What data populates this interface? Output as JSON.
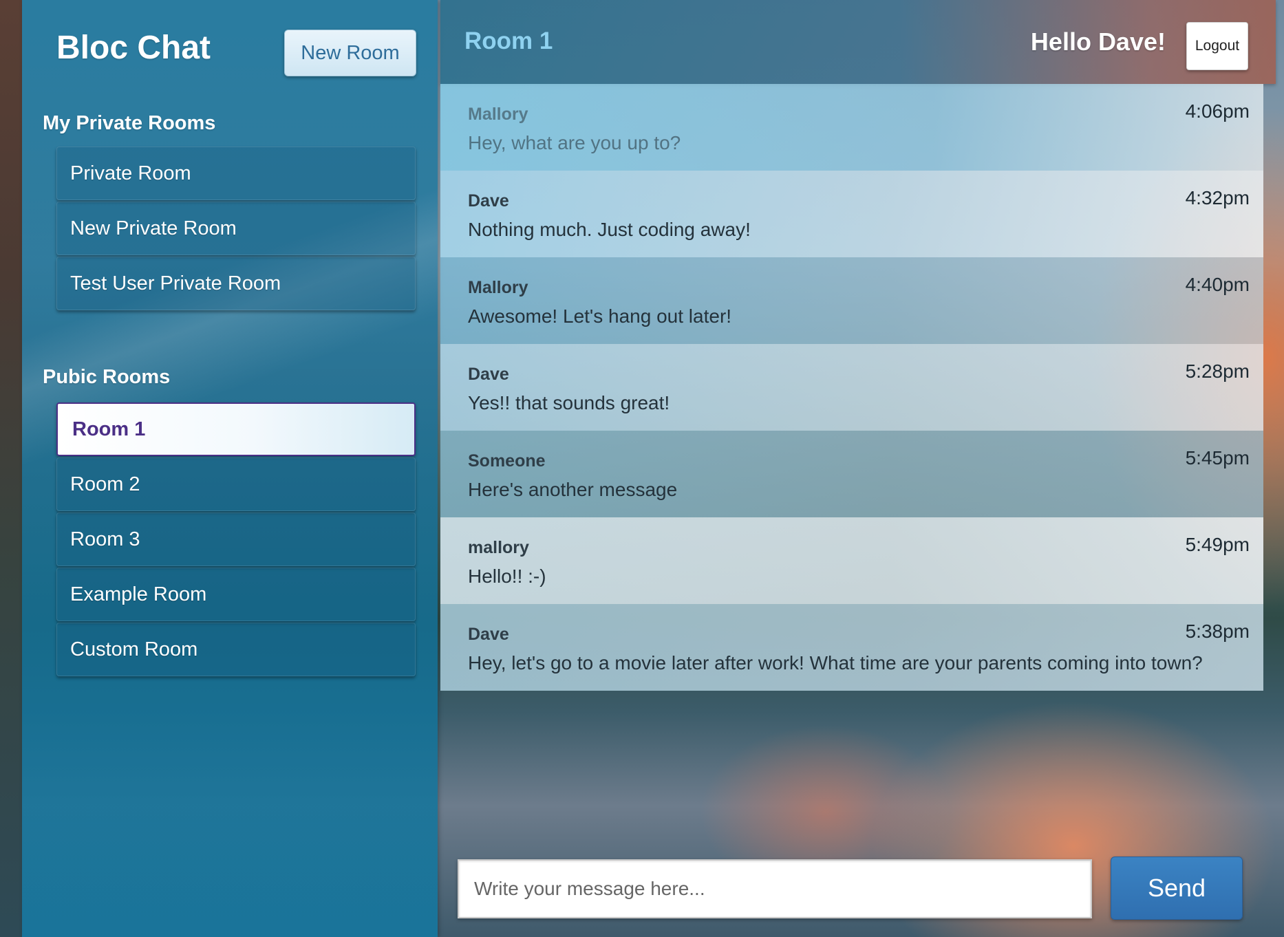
{
  "app": {
    "title": "Bloc Chat",
    "new_room_label": "New Room"
  },
  "sidebar": {
    "private_heading": "My Private Rooms",
    "private_rooms": [
      {
        "label": "Private Room"
      },
      {
        "label": "New Private Room"
      },
      {
        "label": "Test User Private Room"
      }
    ],
    "public_heading": "Pubic Rooms",
    "public_rooms": [
      {
        "label": "Room 1",
        "active": true
      },
      {
        "label": "Room 2"
      },
      {
        "label": "Room 3"
      },
      {
        "label": "Example Room"
      },
      {
        "label": "Custom Room"
      }
    ]
  },
  "header": {
    "room_title": "Room 1",
    "greeting": "Hello Dave!",
    "logout_label": "Logout"
  },
  "messages": [
    {
      "user": "Mallory",
      "text": "Hey, what are you up to?",
      "time": "4:06pm"
    },
    {
      "user": "Dave",
      "text": "Nothing much. Just coding away!",
      "time": "4:32pm"
    },
    {
      "user": "Mallory",
      "text": "Awesome! Let's hang out later!",
      "time": "4:40pm"
    },
    {
      "user": "Dave",
      "text": "Yes!! that sounds great!",
      "time": "5:28pm"
    },
    {
      "user": "Someone",
      "text": "Here's another message",
      "time": "5:45pm"
    },
    {
      "user": "mallory",
      "text": "Hello!! :-)",
      "time": "5:49pm"
    },
    {
      "user": "Dave",
      "text": "Hey, let's go to a movie later after work! What time are your parents coming into town?",
      "time": "5:38pm"
    }
  ],
  "composer": {
    "placeholder": "Write your message here...",
    "value": "",
    "send_label": "Send"
  },
  "colors": {
    "sidebar": "#1a78a0",
    "active_room_text": "#4b2f86",
    "send_button": "#3279bb",
    "room_title": "#8fd2f0"
  }
}
